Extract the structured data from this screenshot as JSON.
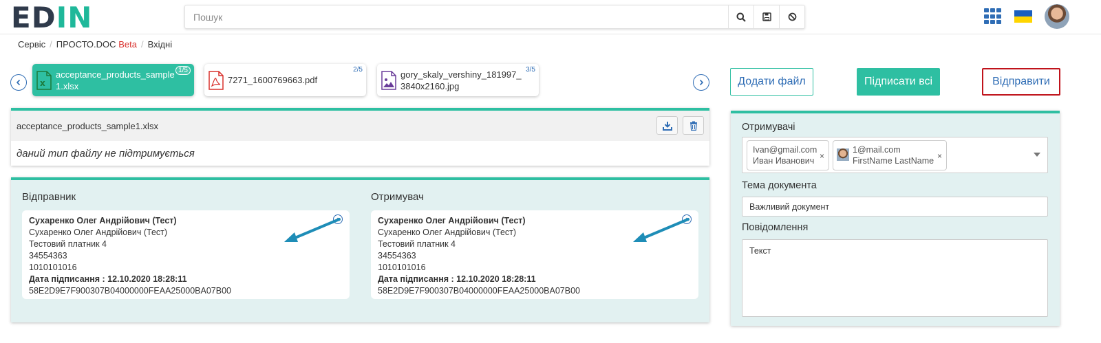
{
  "header": {
    "logo": {
      "part1": "ED",
      "part2": "IN"
    },
    "search_placeholder": "Пошук"
  },
  "breadcrumb": {
    "items": [
      "Сервіс",
      "ПРОСТО.DOC",
      "Вхідні"
    ],
    "beta": "Beta"
  },
  "files": [
    {
      "name": "acceptance_products_sample1.xlsx",
      "count": "1/5",
      "type": "xlsx",
      "active": true
    },
    {
      "name": "7271_1600769663.pdf",
      "count": "2/5",
      "type": "pdf",
      "active": false
    },
    {
      "name": "gory_skaly_vershiny_181997_3840x2160.jpg",
      "count": "3/5",
      "type": "image",
      "active": false
    }
  ],
  "actions": {
    "add_file": "Додати файл",
    "sign_all": "Підписати всі",
    "send": "Відправити"
  },
  "preview": {
    "filename": "acceptance_products_sample1.xlsx",
    "message": "даний тип файлу не підтримується"
  },
  "sender": {
    "title": "Відправник",
    "name_bold": "Сухаренко Олег Андрійович (Тест)",
    "name": "Сухаренко Олег Андрійович (Тест)",
    "payer": "Тестовий платник 4",
    "code1": "34554363",
    "code2": "1010101016",
    "sign_date": "Дата підписання : 12.10.2020 18:28:11",
    "serial": "58E2D9E7F900307B04000000FEAA25000BA07B00"
  },
  "receiver": {
    "title": "Отримувач",
    "name_bold": "Сухаренко Олег Андрійович (Тест)",
    "name": "Сухаренко Олег Андрійович (Тест)",
    "payer": "Тестовий платник 4",
    "code1": "34554363",
    "code2": "1010101016",
    "sign_date": "Дата підписання : 12.10.2020 18:28:11",
    "serial": "58E2D9E7F900307B04000000FEAA25000BA07B00"
  },
  "form": {
    "recipients_label": "Отримувачі",
    "recipients": [
      {
        "email": "Ivan@gmail.com",
        "name": "Иван Иванович",
        "remove": "×"
      },
      {
        "email": "1@mail.com",
        "name": "FirstName LastName",
        "remove": "×"
      }
    ],
    "subject_label": "Тема документа",
    "subject_value": "Важливий документ",
    "message_label": "Повідомлення",
    "message_value": "Текст"
  },
  "colors": {
    "accent": "#2ebfa2",
    "link": "#2f6db5",
    "send_border": "#c0131b",
    "panel_bg": "#e2f1f1"
  }
}
